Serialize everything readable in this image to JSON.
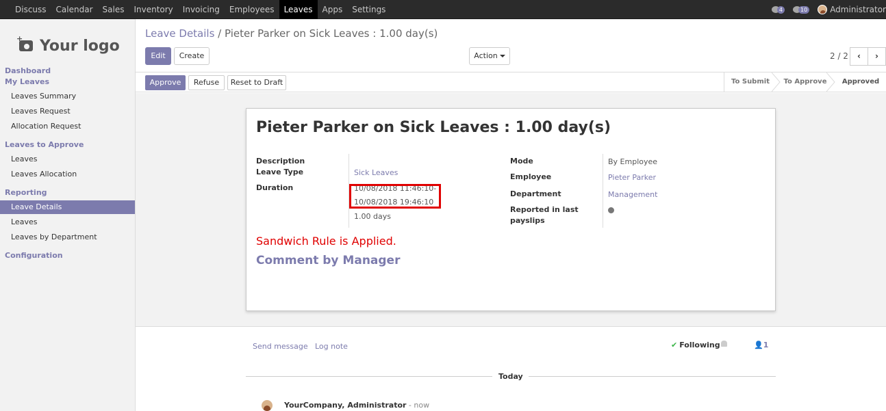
{
  "topbar": {
    "menu": [
      "Discuss",
      "Calendar",
      "Sales",
      "Inventory",
      "Invoicing",
      "Employees",
      "Leaves",
      "Apps",
      "Settings"
    ],
    "active": "Leaves",
    "activity_count": "4",
    "message_count": "10",
    "user": "Administrator"
  },
  "sidebar": {
    "logo_text": "Your logo",
    "dashboard": "Dashboard",
    "my_leaves": "My Leaves",
    "my_leaves_items": [
      "Leaves Summary",
      "Leaves Request",
      "Allocation Request"
    ],
    "to_approve": "Leaves to Approve",
    "to_approve_items": [
      "Leaves",
      "Leaves Allocation"
    ],
    "reporting": "Reporting",
    "reporting_items": [
      "Leave Details",
      "Leaves",
      "Leaves by Department"
    ],
    "configuration": "Configuration"
  },
  "breadcrumb": {
    "parent": "Leave Details",
    "separator": "/",
    "current": "Pieter Parker on Sick Leaves : 1.00 day(s)"
  },
  "toolbar": {
    "edit": "Edit",
    "create": "Create",
    "action": "Action",
    "pager": "2 / 2",
    "prev": "‹",
    "next": "›"
  },
  "statusbar": {
    "approve": "Approve",
    "refuse": "Refuse",
    "reset": "Reset to Draft",
    "stages": [
      "To Submit",
      "To Approve",
      "Approved"
    ],
    "current_stage": "Approved"
  },
  "form": {
    "title": "Pieter Parker on Sick Leaves : 1.00 day(s)",
    "description_label": "Description",
    "leave_type_label": "Leave Type",
    "leave_type": "Sick Leaves",
    "duration_label": "Duration",
    "date_from": "10/08/2018 11:46:10-",
    "date_to": "10/08/2018 19:46:10",
    "days": "1.00 days",
    "mode_label": "Mode",
    "mode": "By Employee",
    "employee_label": "Employee",
    "employee": "Pieter Parker",
    "department_label": "Department",
    "department": "Management",
    "reported_label_1": "Reported in last",
    "reported_label_2": "payslips",
    "sandwich_note": "Sandwich Rule is Applied.",
    "comment_heading": "Comment by Manager"
  },
  "chatter": {
    "send_message": "Send message",
    "log_note": "Log note",
    "following": "Following",
    "followers_count": "1",
    "today": "Today",
    "author": "YourCompany, Administrator",
    "time": " - now"
  },
  "colors": {
    "accent": "#7c7bad",
    "highlight": "#e00000",
    "topbar": "#2b2b2b"
  }
}
